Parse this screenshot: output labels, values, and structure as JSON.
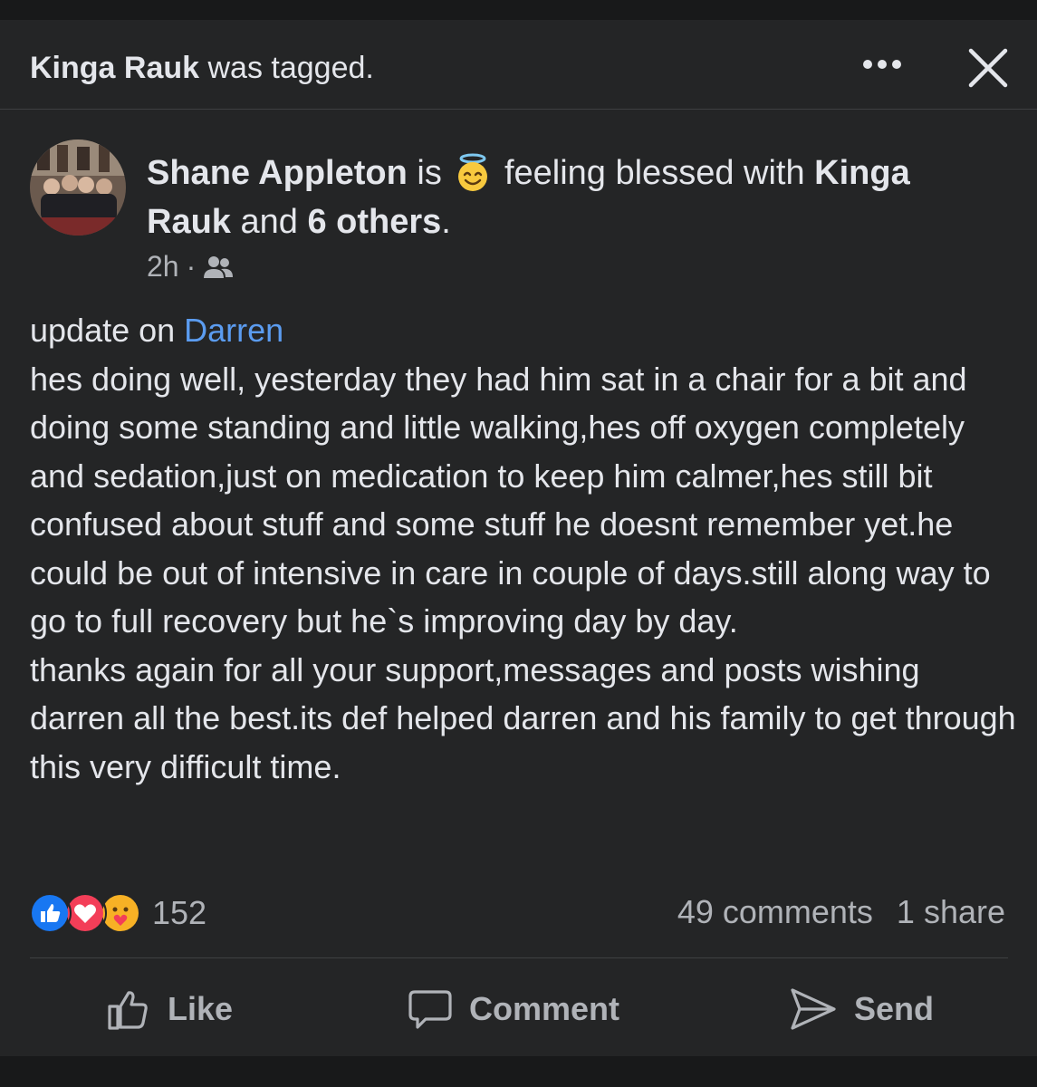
{
  "notification": {
    "tagged_name": "Kinga Rauk",
    "tagged_suffix": " was tagged."
  },
  "post": {
    "author": "Shane Appleton",
    "is_word": " is ",
    "activity": " feeling blessed with ",
    "with_name": "Kinga Rauk",
    "and_word": " and ",
    "others": "6 others",
    "period": ".",
    "time": "2h",
    "dot": "·",
    "body_prefix": "update on ",
    "mention": "Darren",
    "body_rest": "\nhes doing well, yesterday they had him sat in a chair for a bit and doing some standing and little walking,hes off oxygen completely and sedation,just on medication to keep him calmer,hes still bit confused about stuff and some stuff he doesnt remember yet.he could be out of intensive in care in couple of days.still along way to go to full recovery but he`s improving day by day.\nthanks again for all your support,messages and posts wishing darren all the best.its def helped darren and his family to get through this very difficult time."
  },
  "stats": {
    "reaction_count": "152",
    "comments": "49 comments",
    "shares": "1 share"
  },
  "actions": {
    "like": "Like",
    "comment": "Comment",
    "send": "Send"
  },
  "colors": {
    "background": "#242526",
    "text": "#e4e6eb",
    "secondary": "#b0b3b8",
    "mention": "#5b9cf0"
  }
}
